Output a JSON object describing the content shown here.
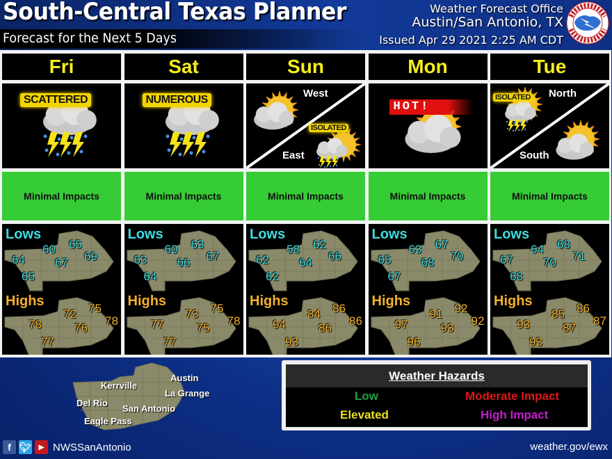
{
  "header": {
    "title": "South-Central Texas Planner",
    "subtitle": "Forecast for the Next 5 Days",
    "office_line1": "Weather Forecast Office",
    "office_line2": "Austin/San Antonio, TX",
    "issued": "Issued Apr 29 2021 2:25 AM CDT",
    "logo_icon": "nws-logo-icon",
    "logo_text": "NATIONAL WEATHER SERVICE"
  },
  "days": [
    {
      "name": "Fri",
      "icon": "thunderstorm-icon",
      "tag": "SCATTERED",
      "impact": "Minimal Impacts",
      "lows": [
        "64",
        "60",
        "65",
        "67",
        "69",
        "65"
      ],
      "highs": [
        "78",
        "72",
        "75",
        "76",
        "78",
        "77"
      ]
    },
    {
      "name": "Sat",
      "icon": "thunderstorm-icon",
      "tag": "NUMEROUS",
      "impact": "Minimal Impacts",
      "lows": [
        "63",
        "60",
        "63",
        "66",
        "67",
        "64"
      ],
      "highs": [
        "77",
        "73",
        "75",
        "75",
        "78",
        "77"
      ]
    },
    {
      "name": "Sun",
      "icon": "split-partly-cloudy-isolated-storm-icon",
      "split": {
        "top": "West",
        "bottom": "East",
        "tag": "ISOLATED"
      },
      "impact": "Minimal Impacts",
      "lows": [
        "62",
        "58",
        "62",
        "64",
        "66",
        "62"
      ],
      "highs": [
        "94",
        "84",
        "86",
        "86",
        "86",
        "93"
      ]
    },
    {
      "name": "Mon",
      "icon": "hot-partly-cloudy-icon",
      "tag": "HOT!",
      "impact": "Minimal Impacts",
      "lows": [
        "65",
        "63",
        "67",
        "68",
        "70",
        "67"
      ],
      "highs": [
        "97",
        "91",
        "92",
        "93",
        "92",
        "96"
      ]
    },
    {
      "name": "Tue",
      "icon": "split-isolated-storm-partly-cloudy-icon",
      "split": {
        "top": "North",
        "bottom": "South",
        "tag": "ISOLATED"
      },
      "impact": "Minimal Impacts",
      "lows": [
        "67",
        "64",
        "68",
        "70",
        "71",
        "68"
      ],
      "highs": [
        "93",
        "85",
        "86",
        "87",
        "87",
        "93"
      ]
    }
  ],
  "labels": {
    "lows": "Lows",
    "highs": "Highs"
  },
  "region_map": {
    "cities": [
      "Austin",
      "Kerrville",
      "La Grange",
      "Del Rio",
      "San Antonio",
      "Eagle Pass"
    ]
  },
  "legend": {
    "title": "Weather Hazards",
    "items": [
      {
        "label": "Low",
        "color": "#1fa24a"
      },
      {
        "label": "Moderate Impact",
        "color": "#e01818"
      },
      {
        "label": "Elevated",
        "color": "#e8e020"
      },
      {
        "label": "High Impact",
        "color": "#c020c8"
      }
    ]
  },
  "footer": {
    "social": [
      "facebook-icon",
      "twitter-icon",
      "youtube-icon"
    ],
    "handle": "NWSSanAntonio",
    "website": "weather.gov/ewx"
  },
  "colors": {
    "impact_green": "#36cc36",
    "day_yellow": "#f5ee1a",
    "lows_cyan": "#3ddde0",
    "highs_orange": "#f5b12a"
  }
}
